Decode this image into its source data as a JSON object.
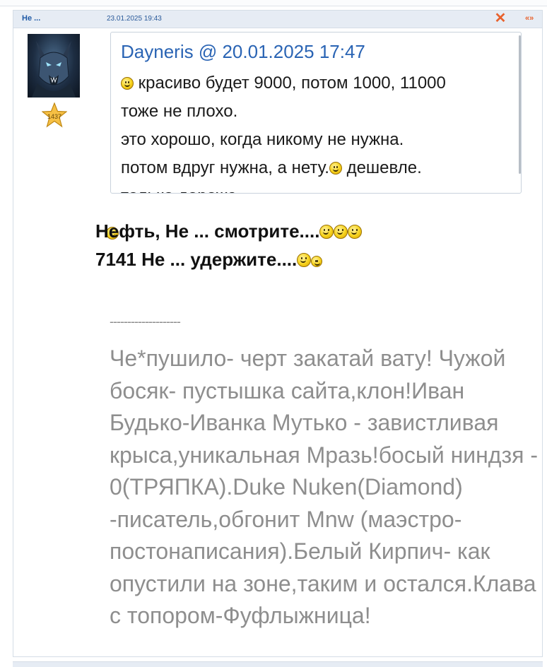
{
  "post": {
    "author": "Не ...",
    "date": "23.01.2025 19:43",
    "delete_icon": "close-x-icon",
    "quote_label": "«»",
    "rank_badge": "1437",
    "accent_color": "#e8612c"
  },
  "quote": {
    "author": "Dayneris",
    "at": "@",
    "date": "20.01.2025 17:47",
    "lines": [
      "красиво будет 9000, потом 1000, 11000",
      "тоже не плохо.",
      "это хорошо, когда никому не нужна.",
      "потом вдруг нужна, а нету.",
      "дешевле.",
      "только дороже"
    ]
  },
  "message": {
    "line1": "Нефть, Не ... смотрите....",
    "line2": "7141 Не ... удержите....",
    "divider": "--------------------",
    "body": "Че*пушило- черт закатай вату! Чужой босяк- пустышка сайта,клон!Иван Будько-Иванка Мутько - завистливая крыса,уникальная Мразь!босый ниндзя - 0(ТРЯПКА).Duke Nuken(Diamond) -писатель,обгонит Mnw (маэстро-постонаписания).Белый Кирпич- как опустили на зоне,таким и остался.Клава с топором-Фуфлыжница!"
  }
}
